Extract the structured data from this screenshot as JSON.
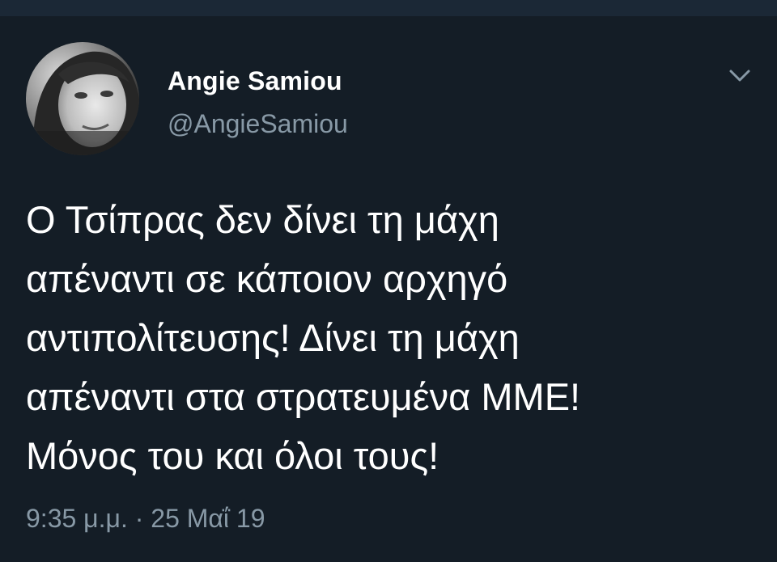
{
  "author": {
    "display_name": "Angie Samiou",
    "handle": "@AngieSamiou",
    "avatar_icon": "profile-photo-avatar"
  },
  "tweet": {
    "lines": [
      "Ο Τσίπρας δεν δίνει τη μάχη",
      "απέναντι σε κάποιον αρχηγό",
      "αντιπολίτευσης! Δίνει τη μάχη",
      "απέναντι στα στρατευμένα ΜΜΕ!",
      "Μόνος του και όλοι τους!"
    ],
    "time": "9:35 μ.μ.",
    "separator": "·",
    "date": "25 Μαΐ 19"
  },
  "icons": {
    "menu": "chevron-down-icon"
  },
  "colors": {
    "background": "#141d26",
    "topbar": "#1b2836",
    "primary_text": "#ffffff",
    "secondary_text": "#8899a6"
  }
}
